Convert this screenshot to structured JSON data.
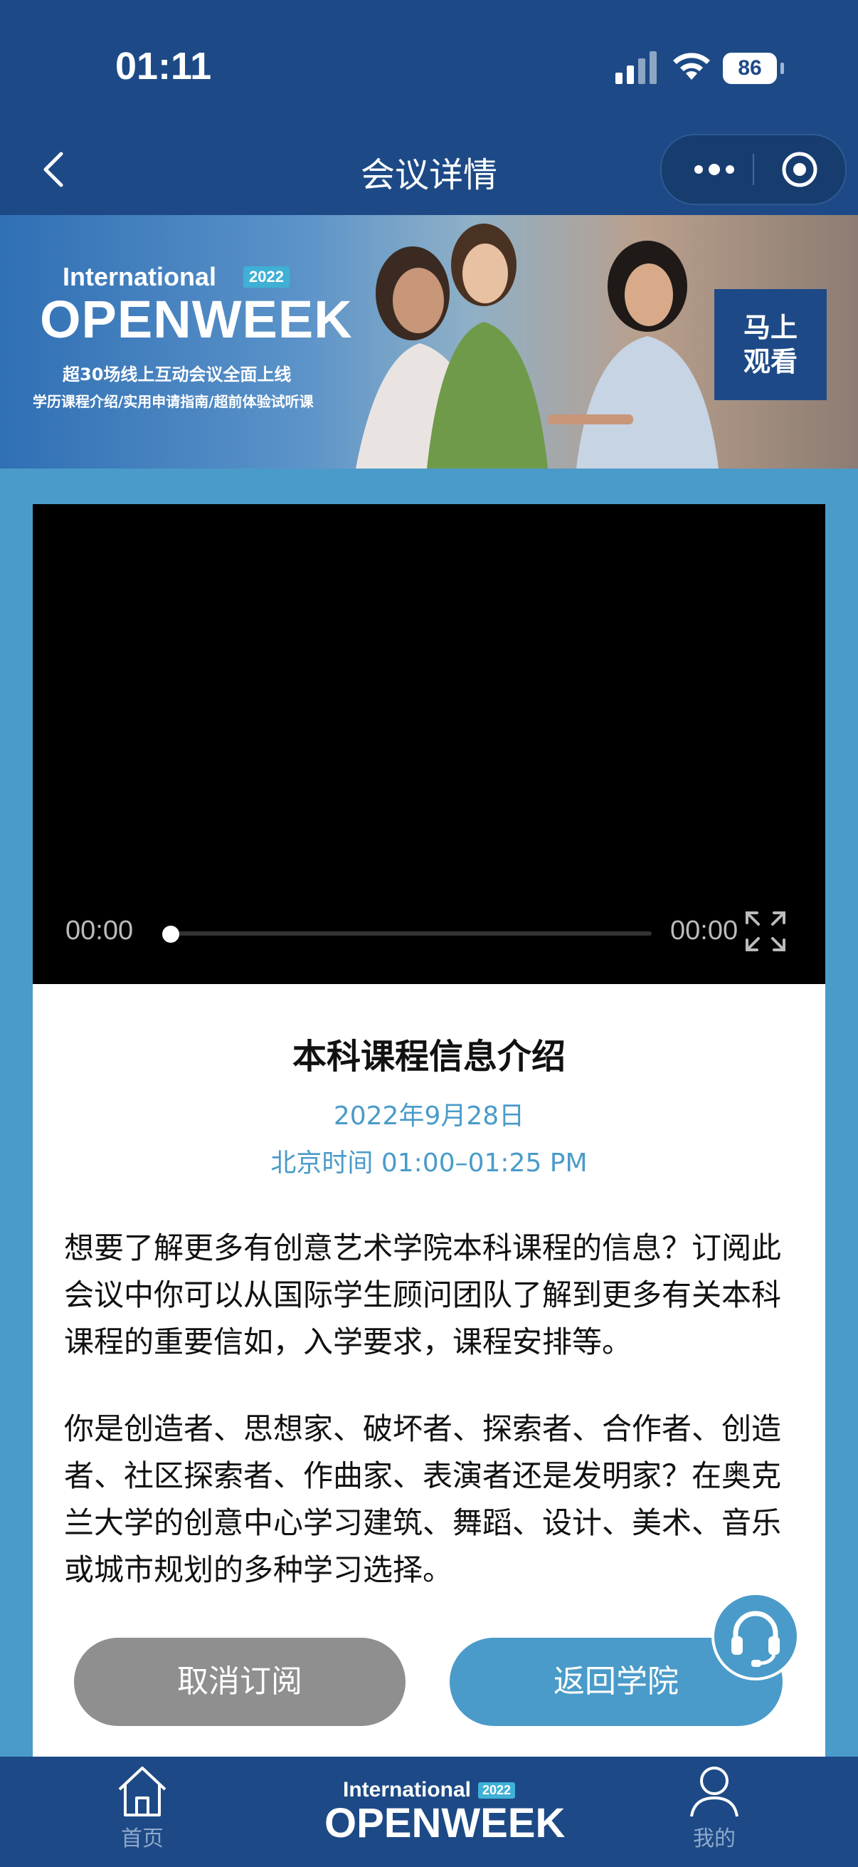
{
  "status": {
    "time": "01:11",
    "battery": "86"
  },
  "nav": {
    "title": "会议详情"
  },
  "banner": {
    "brand_top": "International",
    "brand_year": "2022",
    "brand_main": "OPENWEEK",
    "line1": "超30场线上互动会议全面上线",
    "line2": "学历课程介绍/实用申请指南/超前体验试听课",
    "watch_line1": "马上",
    "watch_line2": "观看"
  },
  "video": {
    "current_time": "00:00",
    "duration": "00:00",
    "progress": 0
  },
  "event": {
    "title": "本科课程信息介绍",
    "date": "2022年9月28日",
    "time": "北京时间 01:00–01:25 PM",
    "paragraph1": "想要了解更多有创意艺术学院本科课程的信息？订阅此会议中你可以从国际学生顾问团队了解到更多有关本科课程的重要信如，入学要求，课程安排等。",
    "paragraph2": "你是创造者、思想家、破坏者、探索者、合作者、创造者、社区探索者、作曲家、表演者还是发明家？在奥克兰大学的创意中心学习建筑、舞蹈、设计、美术、音乐或城市规划的多种学习选择。"
  },
  "buttons": {
    "cancel": "取消订阅",
    "back_to_college": "返回学院"
  },
  "tabbar": {
    "home": "首页",
    "logo_top": "International",
    "logo_year": "2022",
    "logo_main": "OPENWEEK",
    "mine": "我的"
  },
  "colors": {
    "primary_dark": "#1d4a86",
    "accent": "#4a9bc9",
    "cancel_gray": "#8f8f8f"
  }
}
